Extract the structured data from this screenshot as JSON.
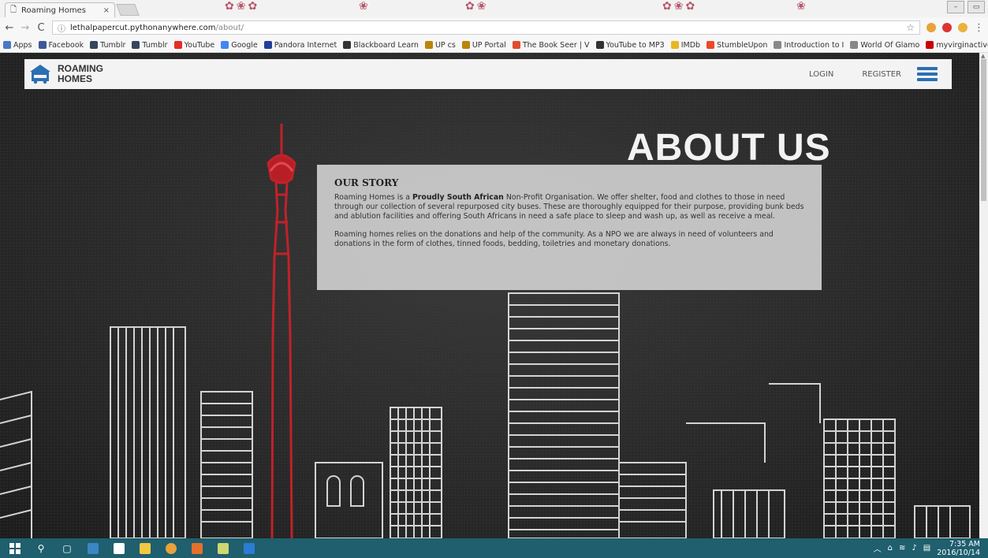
{
  "browser": {
    "tab_title": "Roaming Homes",
    "tab_close": "×",
    "url_host": "lethalpapercut.pythonanywhere.com",
    "url_path": "/about/",
    "bookmarks": [
      {
        "label": "Apps",
        "color": "#4a78c4"
      },
      {
        "label": "Facebook",
        "color": "#3b5998"
      },
      {
        "label": "Tumblr",
        "color": "#36465d"
      },
      {
        "label": "Tumblr",
        "color": "#36465d"
      },
      {
        "label": "YouTube",
        "color": "#e52d27"
      },
      {
        "label": "Google",
        "color": "#4285f4"
      },
      {
        "label": "Pandora Internet",
        "color": "#224099"
      },
      {
        "label": "Blackboard Learn",
        "color": "#333333"
      },
      {
        "label": "UP cs",
        "color": "#b8860b"
      },
      {
        "label": "UP Portal",
        "color": "#b8860b"
      },
      {
        "label": "The Book Seer | V",
        "color": "#e04b2f"
      },
      {
        "label": "YouTube to MP3",
        "color": "#333333"
      },
      {
        "label": "IMDb",
        "color": "#e6b91e"
      },
      {
        "label": "StumbleUpon",
        "color": "#eb4924"
      },
      {
        "label": "Introduction to I",
        "color": "#888888"
      },
      {
        "label": "World Of Glamo",
        "color": "#888888"
      },
      {
        "label": "myvirginactive",
        "color": "#cc0000"
      }
    ],
    "bookmarks_more": "»"
  },
  "site": {
    "logo_line1": "ROAMING",
    "logo_line2": "HOMES",
    "nav_login": "LOGIN",
    "nav_register": "REGISTER",
    "brand_color": "#2b6fb3"
  },
  "hero": {
    "title": "ABOUT US"
  },
  "story": {
    "heading": "OUR STORY",
    "p1_before": "Roaming Homes is a ",
    "p1_bold": "Proudly South African",
    "p1_after": " Non-Profit Organisation. We offer shelter, food and clothes to those in need through our collection of several repurposed city buses. These are thoroughly equipped for their purpose, providing bunk beds and ablution facilities and offering South Africans in need a safe place to sleep and wash up, as well as receive a meal.",
    "p2": "Roaming homes relies on the donations and help of the community. As a NPO we are always in need of volunteers and donations in the form of clothes, tinned foods, bedding, toiletries and monetary donations."
  },
  "taskbar": {
    "time": "7:35 AM",
    "date": "2016/10/14",
    "color": "#1f5f6e"
  }
}
